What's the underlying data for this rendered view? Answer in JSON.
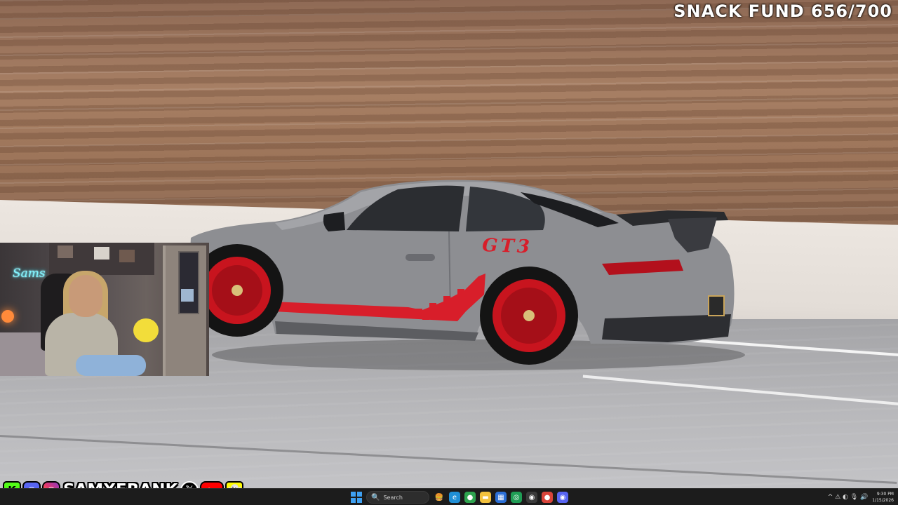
{
  "overlay": {
    "snack_fund_label": "SNACK FUND",
    "snack_fund_value": "656/700",
    "webcam_neon_sign": "Sams"
  },
  "socials": {
    "handle": "SAMXFRANK",
    "icons": [
      "kick-icon",
      "discord-icon",
      "instagram-icon",
      "x-icon",
      "youtube-icon",
      "snapchat-icon"
    ],
    "kick_glyph": "K",
    "x_glyph": "𝕏",
    "youtube_glyph": "▶",
    "snap_glyph": "👻",
    "discord_glyph": "◉",
    "insta_glyph": "◎"
  },
  "car": {
    "badge_text": "GT3",
    "colors": {
      "body": "#8d8e92",
      "accent": "#d81e2a",
      "rim": "#c8141e"
    }
  },
  "taskbar": {
    "search_placeholder": "Search",
    "search_icon": "🔍",
    "apps": [
      {
        "name": "widgets-app",
        "glyph": "🍔",
        "bg": "#1c1c1c"
      },
      {
        "name": "edge-app",
        "glyph": "e",
        "bg": "#1f8fd6"
      },
      {
        "name": "chrome-app",
        "glyph": "●",
        "bg": "#2ea44f"
      },
      {
        "name": "file-explorer-app",
        "glyph": "▬",
        "bg": "#f2c13d"
      },
      {
        "name": "store-app",
        "glyph": "▦",
        "bg": "#2b6fd6"
      },
      {
        "name": "xbox-app",
        "glyph": "◎",
        "bg": "#1f9d55"
      },
      {
        "name": "obs-app",
        "glyph": "◉",
        "bg": "#3a3a3a"
      },
      {
        "name": "chrome-2-app",
        "glyph": "●",
        "bg": "#d9443a"
      },
      {
        "name": "discord-app",
        "glyph": "◉",
        "bg": "#5865f2"
      }
    ],
    "tray_icons": "^ ⚠ ◐ 🎙 🔊",
    "time": "9:30 PM",
    "date": "1/15/2026"
  }
}
